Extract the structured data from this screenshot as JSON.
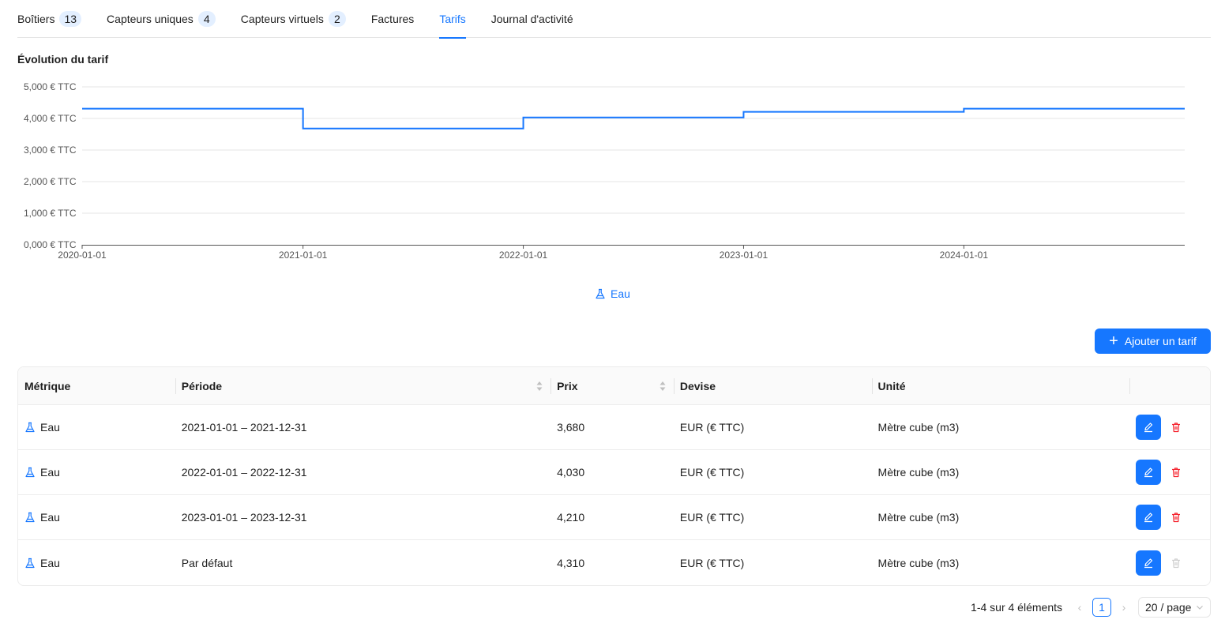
{
  "tabs": [
    {
      "label": "Boîtiers",
      "badge": "13"
    },
    {
      "label": "Capteurs uniques",
      "badge": "4"
    },
    {
      "label": "Capteurs virtuels",
      "badge": "2"
    },
    {
      "label": "Factures",
      "badge": null
    },
    {
      "label": "Tarifs",
      "badge": null,
      "active": true
    },
    {
      "label": "Journal d'activité",
      "badge": null
    }
  ],
  "chart_title": "Évolution du tarif",
  "legend_label": "Eau",
  "colors": {
    "accent": "#1677ff",
    "danger": "#f5222d",
    "disabled": "#cfcfcf"
  },
  "chart_data": {
    "type": "line",
    "step": true,
    "series": [
      {
        "name": "Eau",
        "points": [
          {
            "x": "2020-01-01",
            "y": 4.31
          },
          {
            "x": "2021-01-01",
            "y": 3.68
          },
          {
            "x": "2022-01-01",
            "y": 4.03
          },
          {
            "x": "2023-01-01",
            "y": 4.21
          },
          {
            "x": "2024-01-01",
            "y": 4.31
          },
          {
            "x": "2025-01-01",
            "y": 4.31
          }
        ]
      }
    ],
    "x_ticks": [
      "2020-01-01",
      "2021-01-01",
      "2022-01-01",
      "2023-01-01",
      "2024-01-01"
    ],
    "y_ticks": [
      "0,000 € TTC",
      "1,000 € TTC",
      "2,000 € TTC",
      "3,000 € TTC",
      "4,000 € TTC",
      "5,000 € TTC"
    ],
    "ylim": [
      0,
      5
    ],
    "xlim": [
      "2020-01-01",
      "2025-01-01"
    ],
    "grid": true,
    "legend_position": "bottom-center"
  },
  "add_button_label": "Ajouter un tarif",
  "table": {
    "headers": [
      "Métrique",
      "Période",
      "Prix",
      "Devise",
      "Unité"
    ],
    "rows": [
      {
        "metric": "Eau",
        "period": "2021-01-01 – 2021-12-31",
        "price": "3,680",
        "currency": "EUR (€ TTC)",
        "unit": "Mètre cube (m3)",
        "deletable": true
      },
      {
        "metric": "Eau",
        "period": "2022-01-01 – 2022-12-31",
        "price": "4,030",
        "currency": "EUR (€ TTC)",
        "unit": "Mètre cube (m3)",
        "deletable": true
      },
      {
        "metric": "Eau",
        "period": "2023-01-01 – 2023-12-31",
        "price": "4,210",
        "currency": "EUR (€ TTC)",
        "unit": "Mètre cube (m3)",
        "deletable": true
      },
      {
        "metric": "Eau",
        "period": "Par défaut",
        "price": "4,310",
        "currency": "EUR (€ TTC)",
        "unit": "Mètre cube (m3)",
        "deletable": false
      }
    ]
  },
  "pagination": {
    "total_text": "1-4 sur 4 éléments",
    "current_page": "1",
    "page_size": "20 / page"
  }
}
